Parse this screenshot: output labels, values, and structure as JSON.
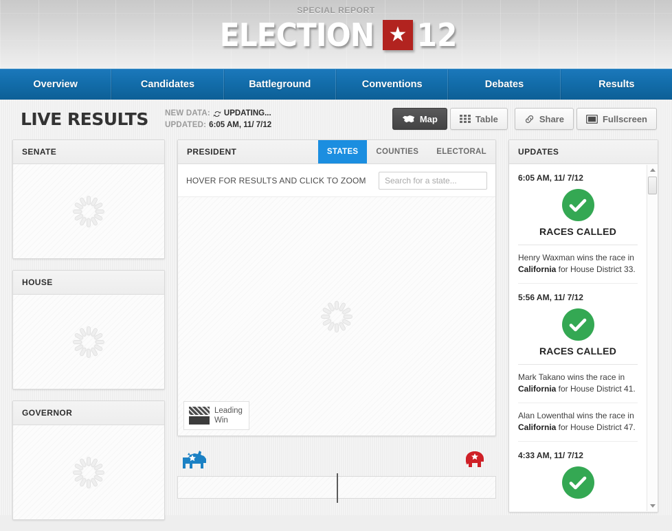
{
  "masthead": {
    "kicker": "SPECIAL REPORT",
    "logo_text": "ELECTION",
    "logo_star": "★",
    "logo_year": "12",
    "star_box_color": "#b2231f"
  },
  "nav": {
    "items": [
      {
        "label": "Overview"
      },
      {
        "label": "Candidates"
      },
      {
        "label": "Battleground"
      },
      {
        "label": "Conventions"
      },
      {
        "label": "Debates"
      },
      {
        "label": "Results"
      }
    ],
    "accent_color": "#126ca9"
  },
  "toolbar": {
    "page_title": "LIVE RESULTS",
    "new_data_label": "NEW DATA:",
    "new_data_value": "UPDATING...",
    "refresh_icon": "refresh-icon",
    "updated_label": "UPDATED:",
    "updated_value": "6:05 AM, 11/ 7/12",
    "view_buttons": [
      {
        "label": "Map",
        "icon": "us-map-icon",
        "active": true
      },
      {
        "label": "Table",
        "icon": "grid-icon",
        "active": false
      }
    ],
    "share_label": "Share",
    "share_icon": "link-icon",
    "fullscreen_label": "Fullscreen",
    "fullscreen_icon": "fullscreen-icon"
  },
  "sidebar": {
    "panels": [
      {
        "title": "SENATE",
        "state": "loading"
      },
      {
        "title": "HOUSE",
        "state": "loading"
      },
      {
        "title": "GOVERNOR",
        "state": "loading"
      }
    ]
  },
  "president": {
    "title": "PRESIDENT",
    "tabs": [
      {
        "label": "STATES",
        "active": true
      },
      {
        "label": "COUNTIES",
        "active": false
      },
      {
        "label": "ELECTORAL",
        "active": false
      }
    ],
    "active_tab_color": "#1b8ee0",
    "hover_hint": "HOVER FOR RESULTS AND CLICK TO ZOOM",
    "search_placeholder": "Search for a state...",
    "search_value": "",
    "map_state": "loading",
    "legend": [
      {
        "label": "Leading",
        "style": "hatched"
      },
      {
        "label": "Win",
        "style": "solid"
      }
    ]
  },
  "tally": {
    "democrat_icon": "donkey-icon",
    "democrat_color": "#1b81c4",
    "republican_icon": "elephant-icon",
    "republican_color": "#cf2027"
  },
  "updates": {
    "title": "UPDATES",
    "entries": [
      {
        "time": "6:05 AM, 11/ 7/12",
        "headline": "RACES CALLED",
        "icon": "check-circle-icon",
        "items": [
          {
            "pre": "Henry Waxman wins the race in ",
            "strong": "California",
            "post": " for House District 33."
          }
        ]
      },
      {
        "time": "5:56 AM, 11/ 7/12",
        "headline": "RACES CALLED",
        "icon": "check-circle-icon",
        "items": [
          {
            "pre": "Mark Takano wins the race in ",
            "strong": "California",
            "post": " for House District 41."
          },
          {
            "pre": "Alan Lowenthal wins the race in ",
            "strong": "California",
            "post": " for House District 47."
          }
        ]
      },
      {
        "time": "4:33 AM, 11/ 7/12",
        "headline": "",
        "icon": "check-circle-icon",
        "items": []
      }
    ],
    "check_color": "#34a853"
  }
}
